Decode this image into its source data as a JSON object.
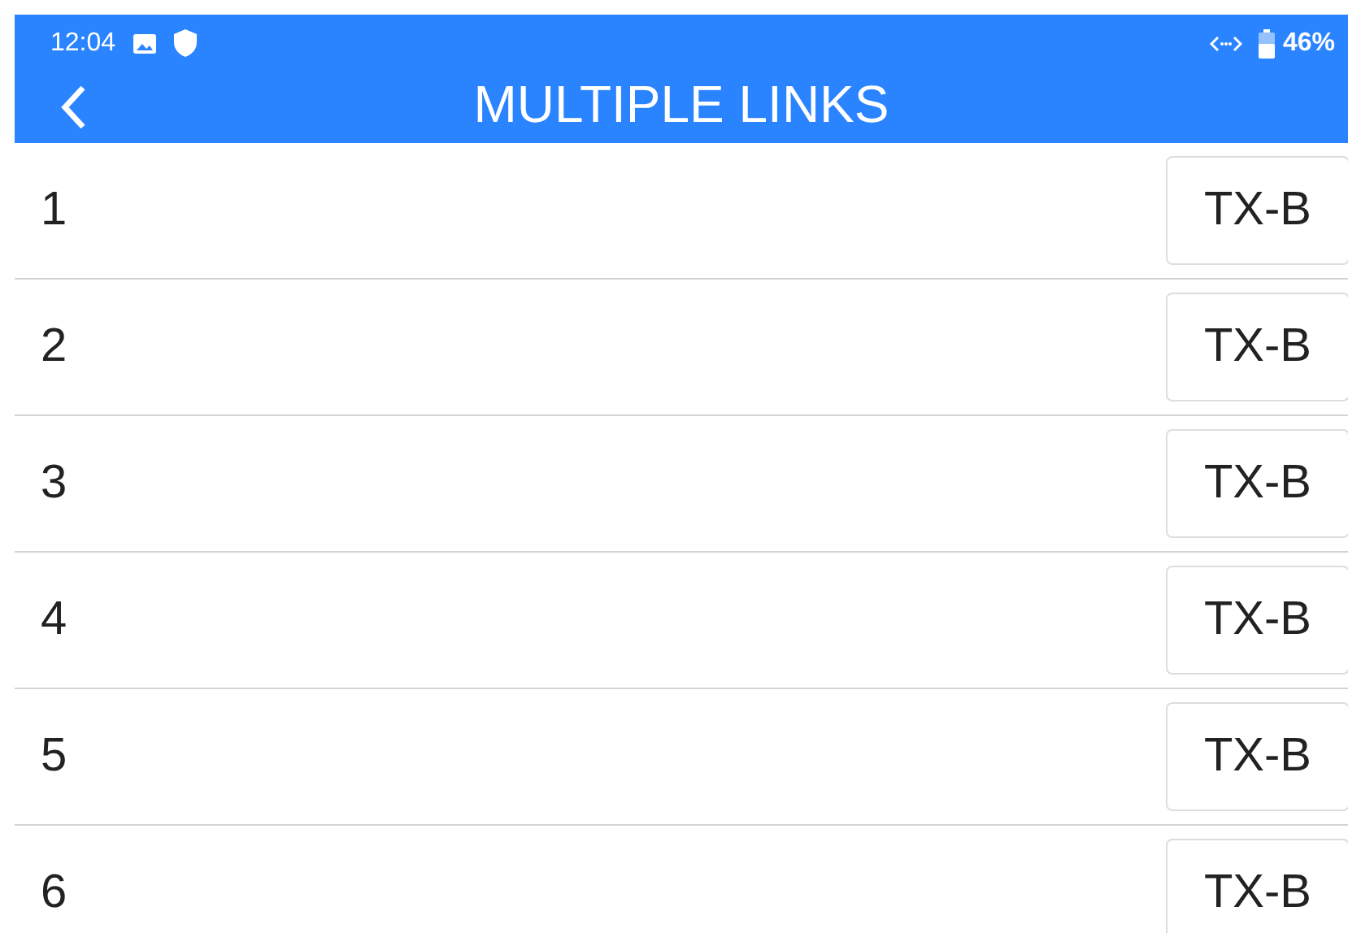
{
  "status_bar": {
    "time": "12:04",
    "battery": "46%"
  },
  "title": "MULTIPLE LINKS",
  "links": [
    {
      "number": "1",
      "transmitter": "TX-B"
    },
    {
      "number": "2",
      "transmitter": "TX-B"
    },
    {
      "number": "3",
      "transmitter": "TX-B"
    },
    {
      "number": "4",
      "transmitter": "TX-B"
    },
    {
      "number": "5",
      "transmitter": "TX-B"
    },
    {
      "number": "6",
      "transmitter": "TX-B"
    }
  ]
}
